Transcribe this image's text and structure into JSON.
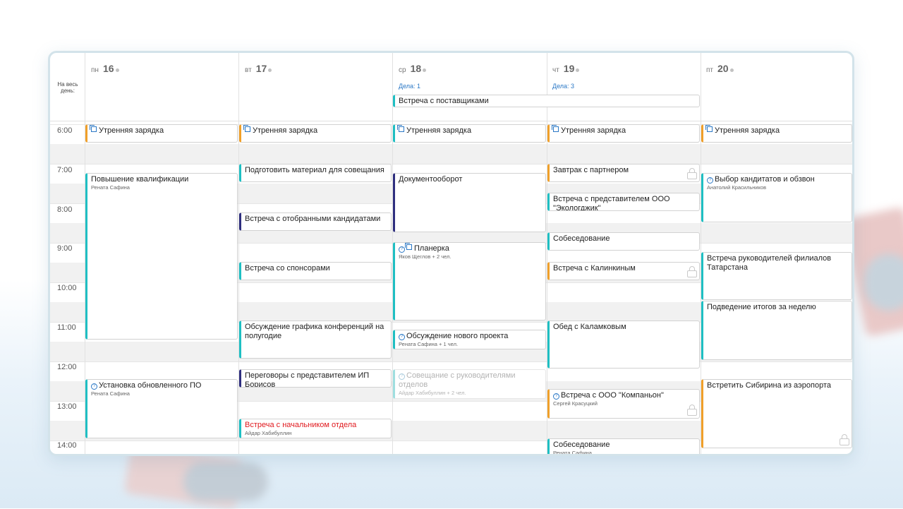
{
  "calendar": {
    "allday_label": "На весь день:",
    "days": [
      {
        "dow": "пн",
        "num": "16"
      },
      {
        "dow": "вт",
        "num": "17"
      },
      {
        "dow": "ср",
        "num": "18",
        "tasks": "Дела: 1"
      },
      {
        "dow": "чт",
        "num": "19",
        "tasks": "Дела: 3"
      },
      {
        "dow": "пт",
        "num": "20"
      }
    ],
    "times": [
      "6:00",
      "7:00",
      "8:00",
      "9:00",
      "10:00",
      "11:00",
      "12:00",
      "13:00",
      "14:00"
    ],
    "allday_events": [
      {
        "title": "Встреча с поставщиками",
        "color": "#1fbfc3"
      }
    ],
    "events": {
      "mon": [
        {
          "title": "Утренняя зарядка",
          "icon": "recurring-icon",
          "color": "#f0a02a"
        },
        {
          "title": "Повышение квалификации",
          "sub": "Рената Сафина",
          "color": "#1fbfc3"
        },
        {
          "title": "Установка обновленного ПО",
          "sub": "Рената Сафина",
          "icon": "clock-icon",
          "color": "#1fbfc3"
        }
      ],
      "tue": [
        {
          "title": "Утренняя зарядка",
          "icon": "recurring-icon",
          "color": "#f0a02a"
        },
        {
          "title": "Подготовить материал для совещания",
          "color": "#1fbfc3"
        },
        {
          "title": "Встреча с отобранными кандидатами",
          "color": "#2f2f7f"
        },
        {
          "title": "Встреча со спонсорами",
          "color": "#1fbfc3"
        },
        {
          "title": "Обсуждение графика конференций на полугодие",
          "color": "#1fbfc3"
        },
        {
          "title": "Переговоры с представителем ИП Борисов",
          "color": "#2f2f7f"
        },
        {
          "title": "Встреча с начальником отдела",
          "sub": "Айдар Хабибуллин",
          "color": "#1fbfc3"
        }
      ],
      "wed": [
        {
          "title": "Утренняя зарядка",
          "icon": "recurring-icon",
          "color": "#1fbfc3"
        },
        {
          "title": "Документооборот",
          "color": "#2f2f7f"
        },
        {
          "title": "Планерка",
          "sub": "Яков Щеглов + 2 чел.",
          "icon": "clock-recurring-icon",
          "color": "#1fbfc3"
        },
        {
          "title": "Обсуждение нового проекта",
          "sub": "Рената Сафина + 1 чел.",
          "icon": "clock-icon",
          "color": "#1fbfc3"
        },
        {
          "title": "Совещание с руководителями отделов",
          "sub": "Айдар Хабибуллин + 2 чел.",
          "icon": "clock-icon",
          "color": "#9fdfe0"
        }
      ],
      "thu": [
        {
          "title": "Утренняя зарядка",
          "icon": "recurring-icon",
          "color": "#f0a02a"
        },
        {
          "title": "Завтрак с партнером",
          "color": "#f0a02a"
        },
        {
          "title": "Встреча с представителем ООО \"Экологджик\"",
          "color": "#1fbfc3"
        },
        {
          "title": "Собеседование",
          "color": "#1fbfc3"
        },
        {
          "title": "Встреча с Калинкиным",
          "color": "#f0a02a"
        },
        {
          "title": "Обед с Каламковым",
          "color": "#1fbfc3"
        },
        {
          "title": "Встреча с ООО \"Компаньон\"",
          "sub": "Сергей Красуцкий",
          "icon": "clock-icon",
          "color": "#f0a02a"
        },
        {
          "title": "Собеседование",
          "sub": "Рената Сафина",
          "color": "#1fbfc3"
        }
      ],
      "fri": [
        {
          "title": "Утренняя зарядка",
          "icon": "recurring-icon",
          "color": "#f0a02a"
        },
        {
          "title": "Выбор кандитатов и обзвон",
          "sub": "Анатолий Красильников",
          "icon": "clock-icon",
          "color": "#1fbfc3"
        },
        {
          "title": "Встреча руководителей филиалов Татарстана",
          "color": "#1fbfc3"
        },
        {
          "title": "Подведение итогов за неделю",
          "color": "#1fbfc3"
        },
        {
          "title": "Встретить Сибирина из аэропорта",
          "color": "#f0a02a"
        }
      ]
    }
  }
}
